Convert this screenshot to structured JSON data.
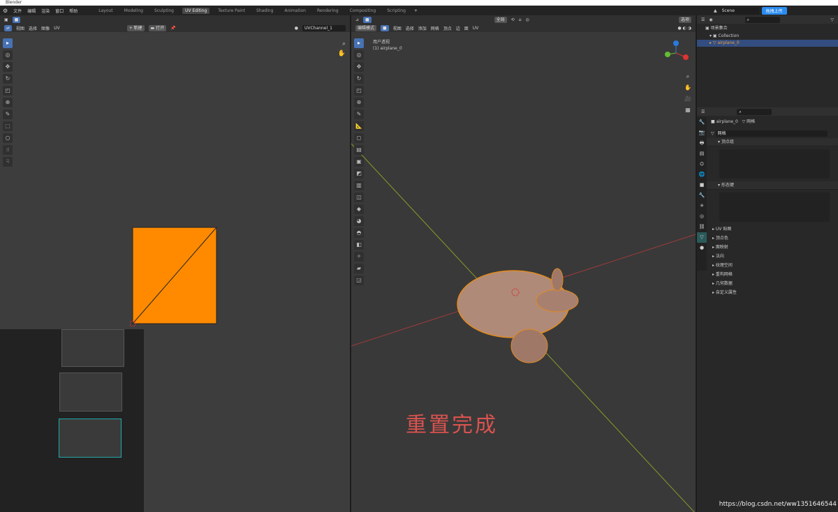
{
  "window": {
    "title": "Blender"
  },
  "menu": [
    "文件",
    "编辑",
    "渲染",
    "窗口",
    "帮助"
  ],
  "workspaces": [
    "Layout",
    "Modeling",
    "Sculpting",
    "UV Editing",
    "Texture Paint",
    "Shading",
    "Animation",
    "Rendering",
    "Compositing",
    "Scripting"
  ],
  "active_workspace": "UV Editing",
  "uv_editor": {
    "menus": [
      "视图",
      "选择",
      "图像",
      "UV"
    ],
    "new_label": "新建",
    "open_label": "打开",
    "uv_channel": "UVChannel_1"
  },
  "viewport": {
    "transform": "全局",
    "options": "选项",
    "mode": "编辑模式",
    "menus": [
      "视图",
      "选择",
      "添加",
      "网格",
      "顶点",
      "边",
      "面",
      "UV"
    ],
    "view_name": "用户透视",
    "object_info": "(1) airplane_0",
    "overlay_text": "重置完成"
  },
  "top_right": {
    "scene": "Scene",
    "upload": "拖拽上传"
  },
  "outliner": {
    "root": "场景集合",
    "collection": "Collection",
    "object": "airplane_0"
  },
  "properties": {
    "object": "airplane_0",
    "data": "网格",
    "mesh_name": "网格",
    "sections_open": [
      "顶点组",
      "形态键"
    ],
    "sections": [
      "UV 贴图",
      "顶点色",
      "面映射",
      "法向",
      "纹理空间",
      "重构网格",
      "几何数据",
      "自定义属性"
    ]
  },
  "watermark": "https://blog.csdn.net/ww1351646544",
  "colors": {
    "accent": "#4772b3",
    "uv_face": "#ff8a00",
    "overlay_text": "#d9534f"
  }
}
